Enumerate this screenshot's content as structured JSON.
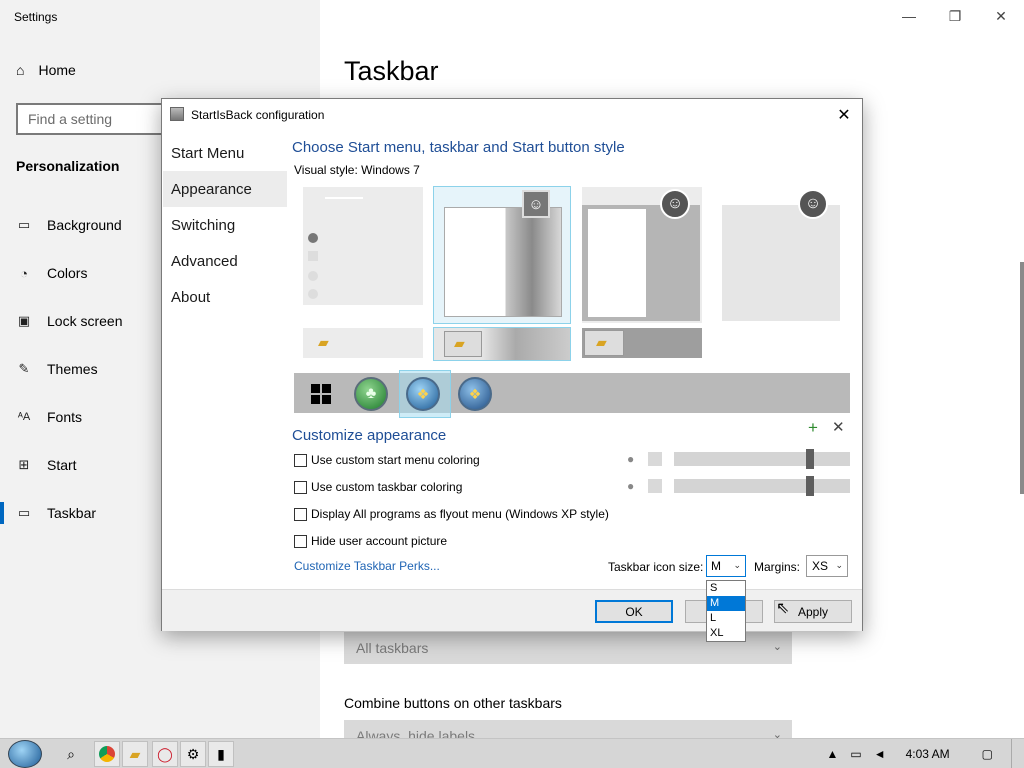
{
  "settings": {
    "window_title": "Settings",
    "home": "Home",
    "search_placeholder": "Find a setting",
    "section": "Personalization",
    "nav": [
      {
        "label": "Background",
        "icon": "picture-icon"
      },
      {
        "label": "Colors",
        "icon": "palette-icon"
      },
      {
        "label": "Lock screen",
        "icon": "lock-screen-icon"
      },
      {
        "label": "Themes",
        "icon": "themes-icon"
      },
      {
        "label": "Fonts",
        "icon": "fonts-icon"
      },
      {
        "label": "Start",
        "icon": "start-icon"
      },
      {
        "label": "Taskbar",
        "icon": "taskbar-icon"
      }
    ],
    "active_nav": "Taskbar",
    "page_heading": "Taskbar",
    "dropdown_1_value": "All taskbars",
    "combine_label": "Combine buttons on other taskbars",
    "dropdown_2_value": "Always, hide labels"
  },
  "dialog": {
    "title": "StartIsBack configuration",
    "sidebar": [
      "Start Menu",
      "Appearance",
      "Switching",
      "Advanced",
      "About"
    ],
    "active_tab": "Appearance",
    "style_heading": "Choose Start menu, taskbar and Start button style",
    "visual_style_label": "Visual style:",
    "visual_style_value": "Windows 7",
    "customize_heading": "Customize appearance",
    "checkboxes": [
      {
        "label": "Use custom start menu coloring",
        "checked": false
      },
      {
        "label": "Use custom taskbar coloring",
        "checked": false
      },
      {
        "label": "Display All programs as flyout menu (Windows XP style)",
        "checked": false
      },
      {
        "label": "Hide user account picture",
        "checked": false
      }
    ],
    "perks_link": "Customize Taskbar Perks...",
    "icon_size_label": "Taskbar icon size:",
    "icon_size_value": "M",
    "icon_size_options": [
      "S",
      "M",
      "L",
      "XL"
    ],
    "margins_label": "Margins:",
    "margins_value": "XS",
    "buttons": {
      "ok": "OK",
      "apply": "Apply"
    },
    "slider_levels": [
      0.75,
      0.75
    ]
  },
  "taskbar": {
    "time": "4:03 AM",
    "pinned": [
      "search-icon",
      "chrome-icon",
      "file-explorer-icon",
      "opera-icon",
      "settings-icon",
      "startisback-icon"
    ]
  },
  "colors": {
    "accent": "#0078d7",
    "heading_blue": "#1f4e96",
    "link_blue": "#1f64b4"
  }
}
